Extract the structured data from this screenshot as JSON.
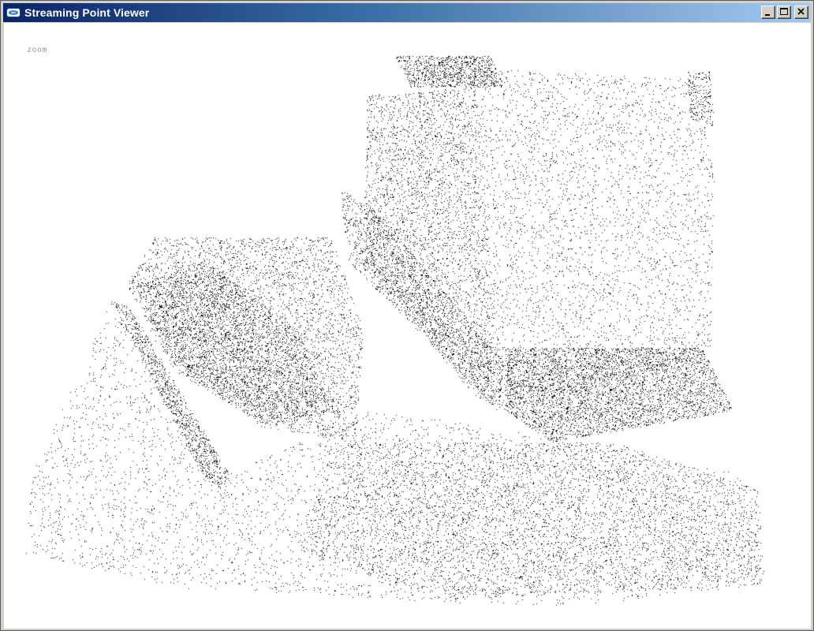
{
  "window": {
    "title": "Streaming Point Viewer",
    "app_icon": "viewer-app-icon",
    "controls": [
      "minimize",
      "maximize",
      "close"
    ]
  },
  "viewport": {
    "mode_label": "zoom",
    "point_color": "#000000",
    "background_color": "#ffffff"
  },
  "colors": {
    "titlebar_start": "#0a246a",
    "titlebar_end": "#a6caf0",
    "title_text": "#ffffff",
    "mode_label": "#9a9a9a"
  }
}
